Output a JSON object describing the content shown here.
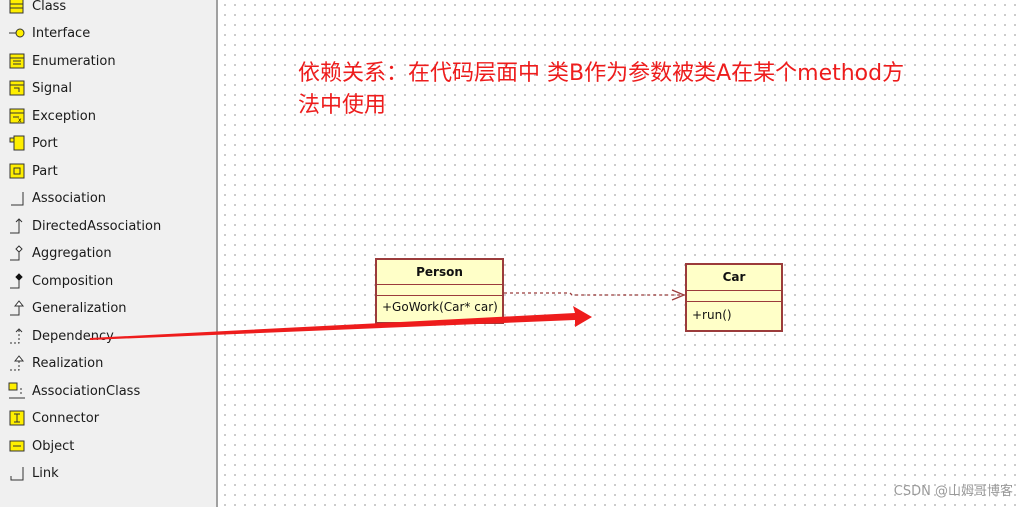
{
  "toolbox": {
    "items": [
      {
        "label": "Class",
        "icon": "class-icon"
      },
      {
        "label": "Interface",
        "icon": "interface-icon"
      },
      {
        "label": "Enumeration",
        "icon": "enumeration-icon"
      },
      {
        "label": "Signal",
        "icon": "signal-icon"
      },
      {
        "label": "Exception",
        "icon": "exception-icon"
      },
      {
        "label": "Port",
        "icon": "port-icon"
      },
      {
        "label": "Part",
        "icon": "part-icon"
      },
      {
        "label": "Association",
        "icon": "association-icon"
      },
      {
        "label": "DirectedAssociation",
        "icon": "directed-association-icon"
      },
      {
        "label": "Aggregation",
        "icon": "aggregation-icon"
      },
      {
        "label": "Composition",
        "icon": "composition-icon"
      },
      {
        "label": "Generalization",
        "icon": "generalization-icon"
      },
      {
        "label": "Dependency",
        "icon": "dependency-icon"
      },
      {
        "label": "Realization",
        "icon": "realization-icon"
      },
      {
        "label": "AssociationClass",
        "icon": "association-class-icon"
      },
      {
        "label": "Connector",
        "icon": "connector-icon"
      },
      {
        "label": "Object",
        "icon": "object-icon"
      },
      {
        "label": "Link",
        "icon": "link-icon"
      }
    ]
  },
  "canvas": {
    "note_line1": "依赖关系：在代码层面中 类B作为参数被类A在某个method方",
    "note_line2": "法中使用",
    "classes": [
      {
        "name": "Person",
        "operations": "+GoWork(Car* car)"
      },
      {
        "name": "Car",
        "operations": "+run()"
      }
    ],
    "relationship": "dependency",
    "watermark": "CSDN @山姆哥博客"
  },
  "colors": {
    "annotation_red": "#ee1c1c",
    "class_fill": "#ffffc8",
    "class_border": "#9b3b3b"
  }
}
